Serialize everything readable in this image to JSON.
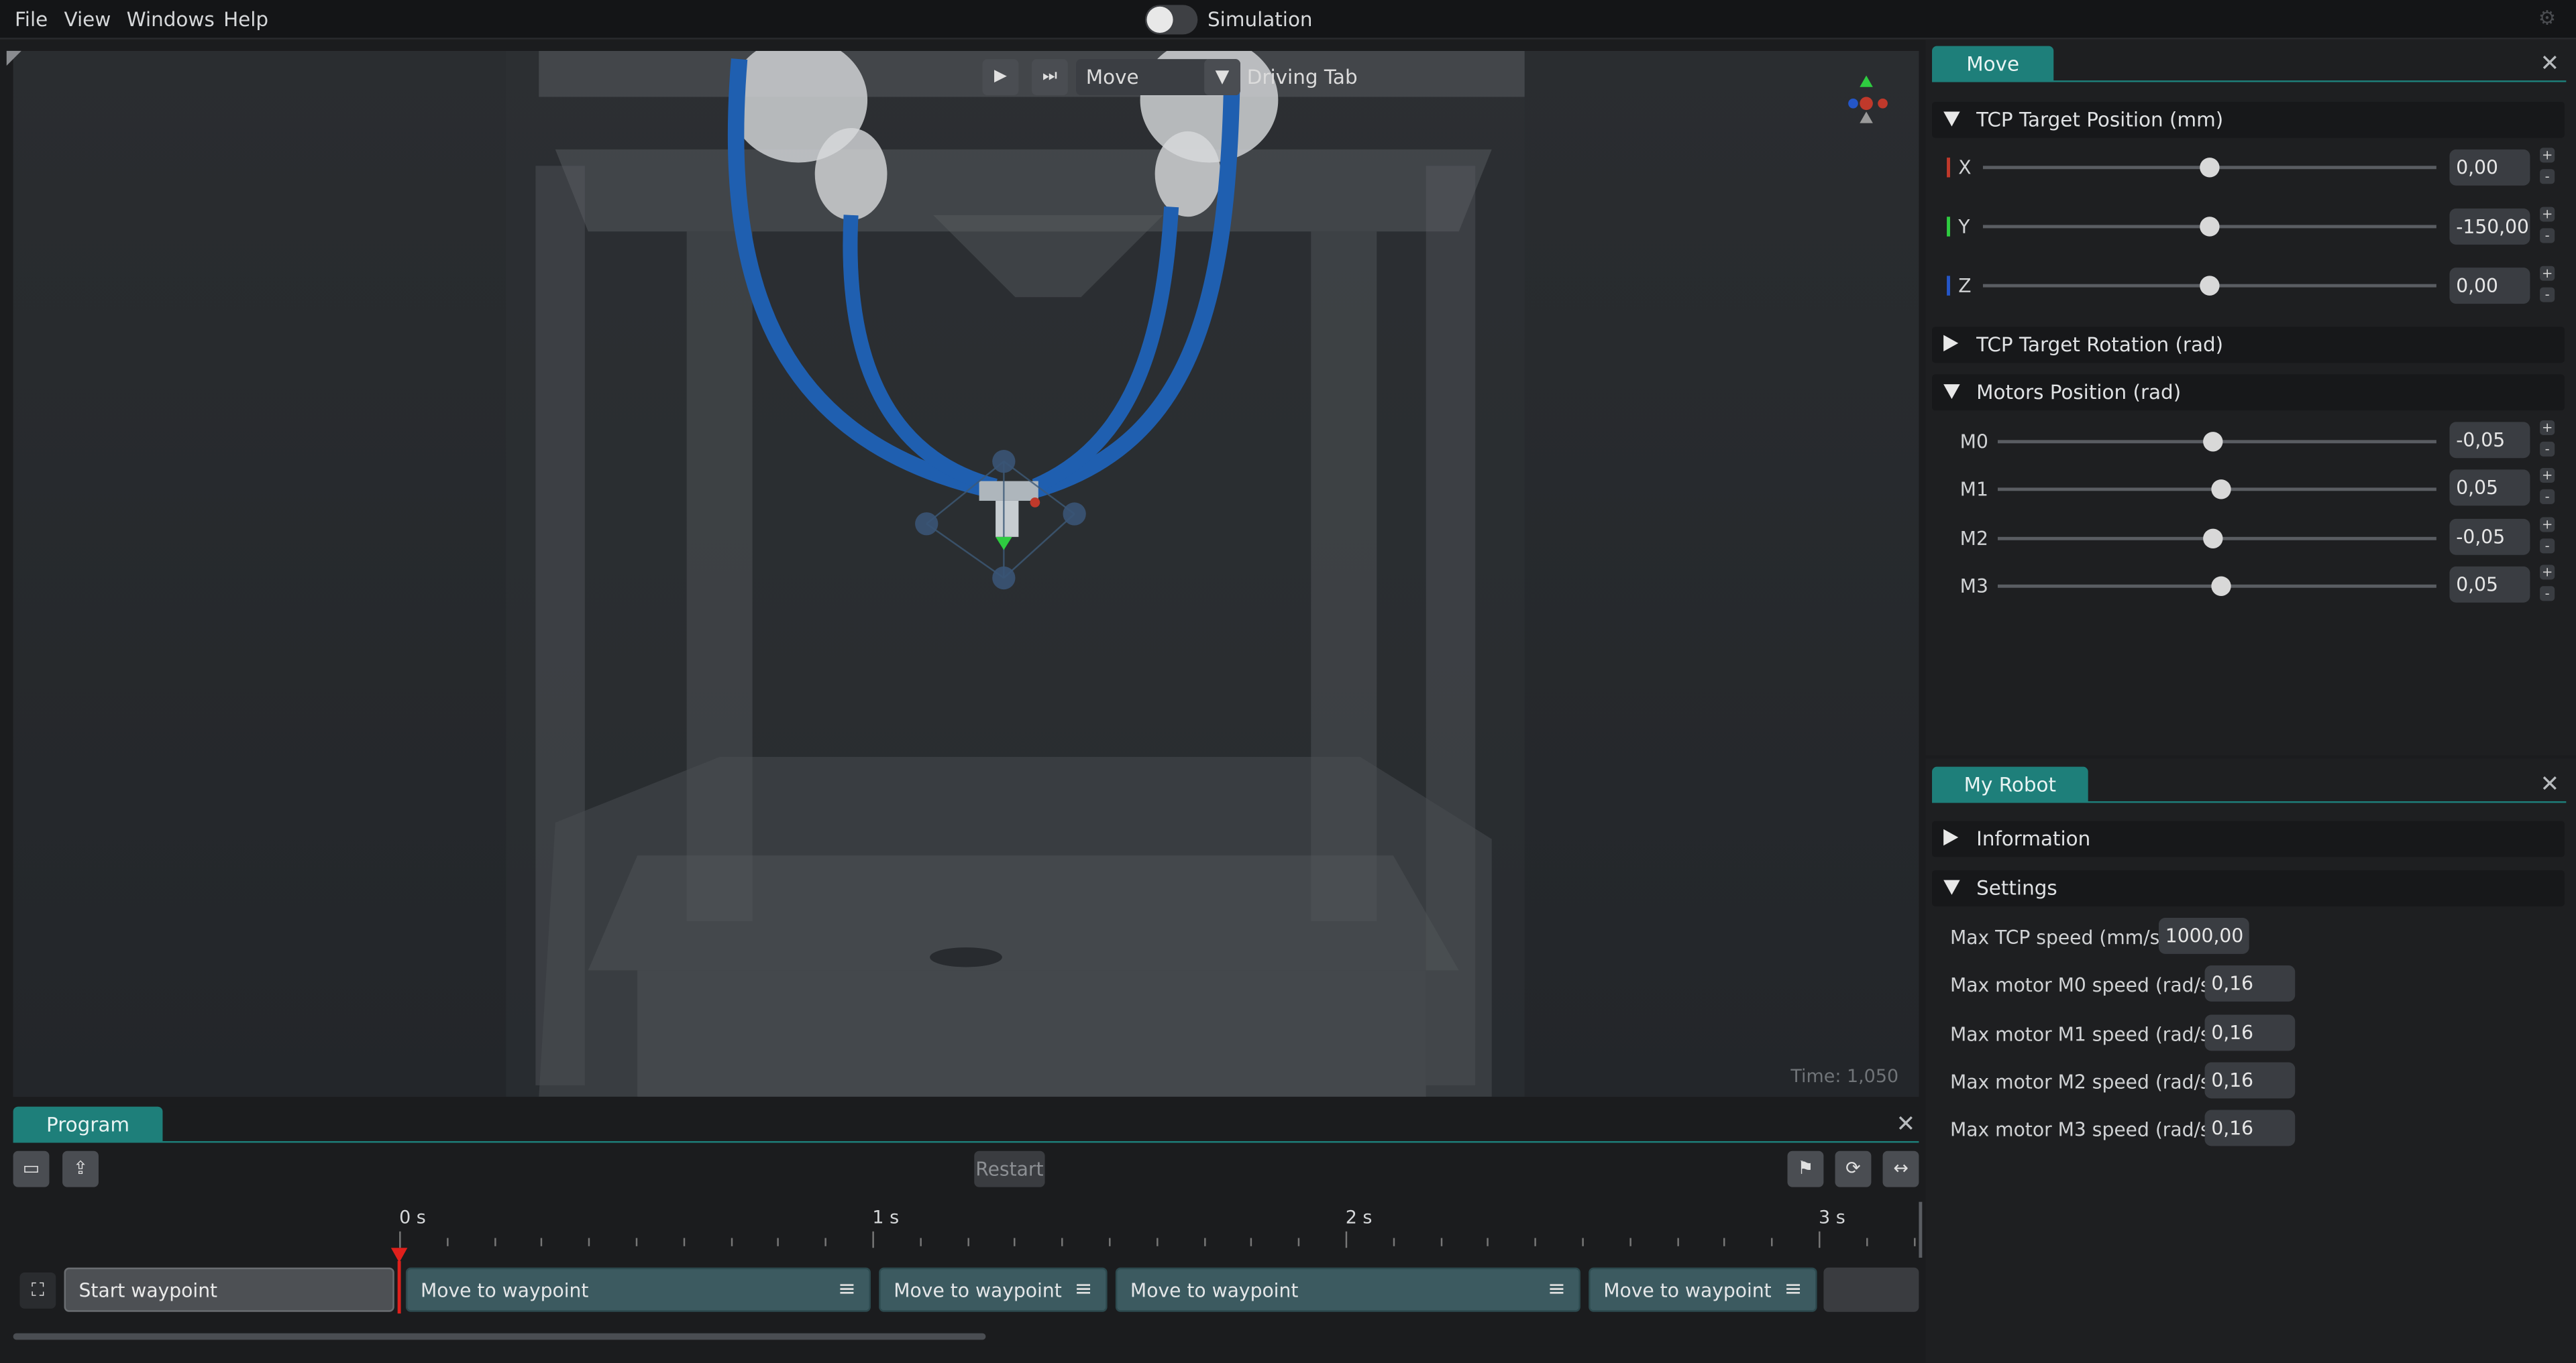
{
  "menubar": {
    "items": [
      "File",
      "View",
      "Windows",
      "Help"
    ],
    "simulation_label": "Simulation"
  },
  "viewport": {
    "mode_label": "Move",
    "tab_label": "Driving Tab",
    "time_label": "Time: 1,050"
  },
  "move_panel": {
    "tab_label": "Move",
    "tcp_position": {
      "title": "TCP Target Position (mm)",
      "rows": [
        {
          "label": "X",
          "value": "0,00",
          "level": 0.5
        },
        {
          "label": "Y",
          "value": "-150,00",
          "level": 0.5
        },
        {
          "label": "Z",
          "value": "0,00",
          "level": 0.5
        }
      ]
    },
    "tcp_rotation": {
      "title": "TCP Target Rotation (rad)"
    },
    "motors": {
      "title": "Motors Position (rad)",
      "rows": [
        {
          "label": "M0",
          "value": "-0,05",
          "level": 0.49
        },
        {
          "label": "M1",
          "value": "0,05",
          "level": 0.51
        },
        {
          "label": "M2",
          "value": "-0,05",
          "level": 0.49
        },
        {
          "label": "M3",
          "value": "0,05",
          "level": 0.51
        }
      ]
    },
    "plus": "+",
    "minus": "-"
  },
  "robot_panel": {
    "tab_label": "My Robot",
    "information_title": "Information",
    "settings_title": "Settings",
    "settings": [
      {
        "label": "Max TCP speed (mm/s):",
        "value": "1000,00"
      },
      {
        "label": "Max motor M0 speed (rad/s):",
        "value": "0,16"
      },
      {
        "label": "Max motor M1 speed (rad/s):",
        "value": "0,16"
      },
      {
        "label": "Max motor M2 speed (rad/s):",
        "value": "0,16"
      },
      {
        "label": "Max motor M3 speed (rad/s):",
        "value": "0,16"
      }
    ]
  },
  "program_panel": {
    "tab_label": "Program",
    "restart_label": "Restart",
    "time_ticks": [
      "0 s",
      "1 s",
      "2 s",
      "3 s"
    ],
    "waypoints": [
      {
        "label": "Start waypoint",
        "kind": "start"
      },
      {
        "label": "Move to waypoint",
        "kind": "move"
      },
      {
        "label": "Move to waypoint",
        "kind": "move"
      },
      {
        "label": "Move to waypoint",
        "kind": "move"
      },
      {
        "label": "Move to waypoint",
        "kind": "move"
      }
    ]
  },
  "colors": {
    "accent": "#1e7f7a",
    "waypoint": "#3c5a60",
    "axis_x": "#c0392b",
    "axis_y": "#2ecc40",
    "axis_z": "#2456c8",
    "cable": "#1f5fb0"
  },
  "icons": [
    "play-icon",
    "step-forward-icon",
    "dropdown-caret-icon",
    "axis-gizmo-icon",
    "close-icon",
    "expand-icon",
    "folder-open-icon",
    "upload-icon",
    "flag-icon",
    "loop-icon",
    "fit-width-icon",
    "menu-icon",
    "gear-icon"
  ]
}
